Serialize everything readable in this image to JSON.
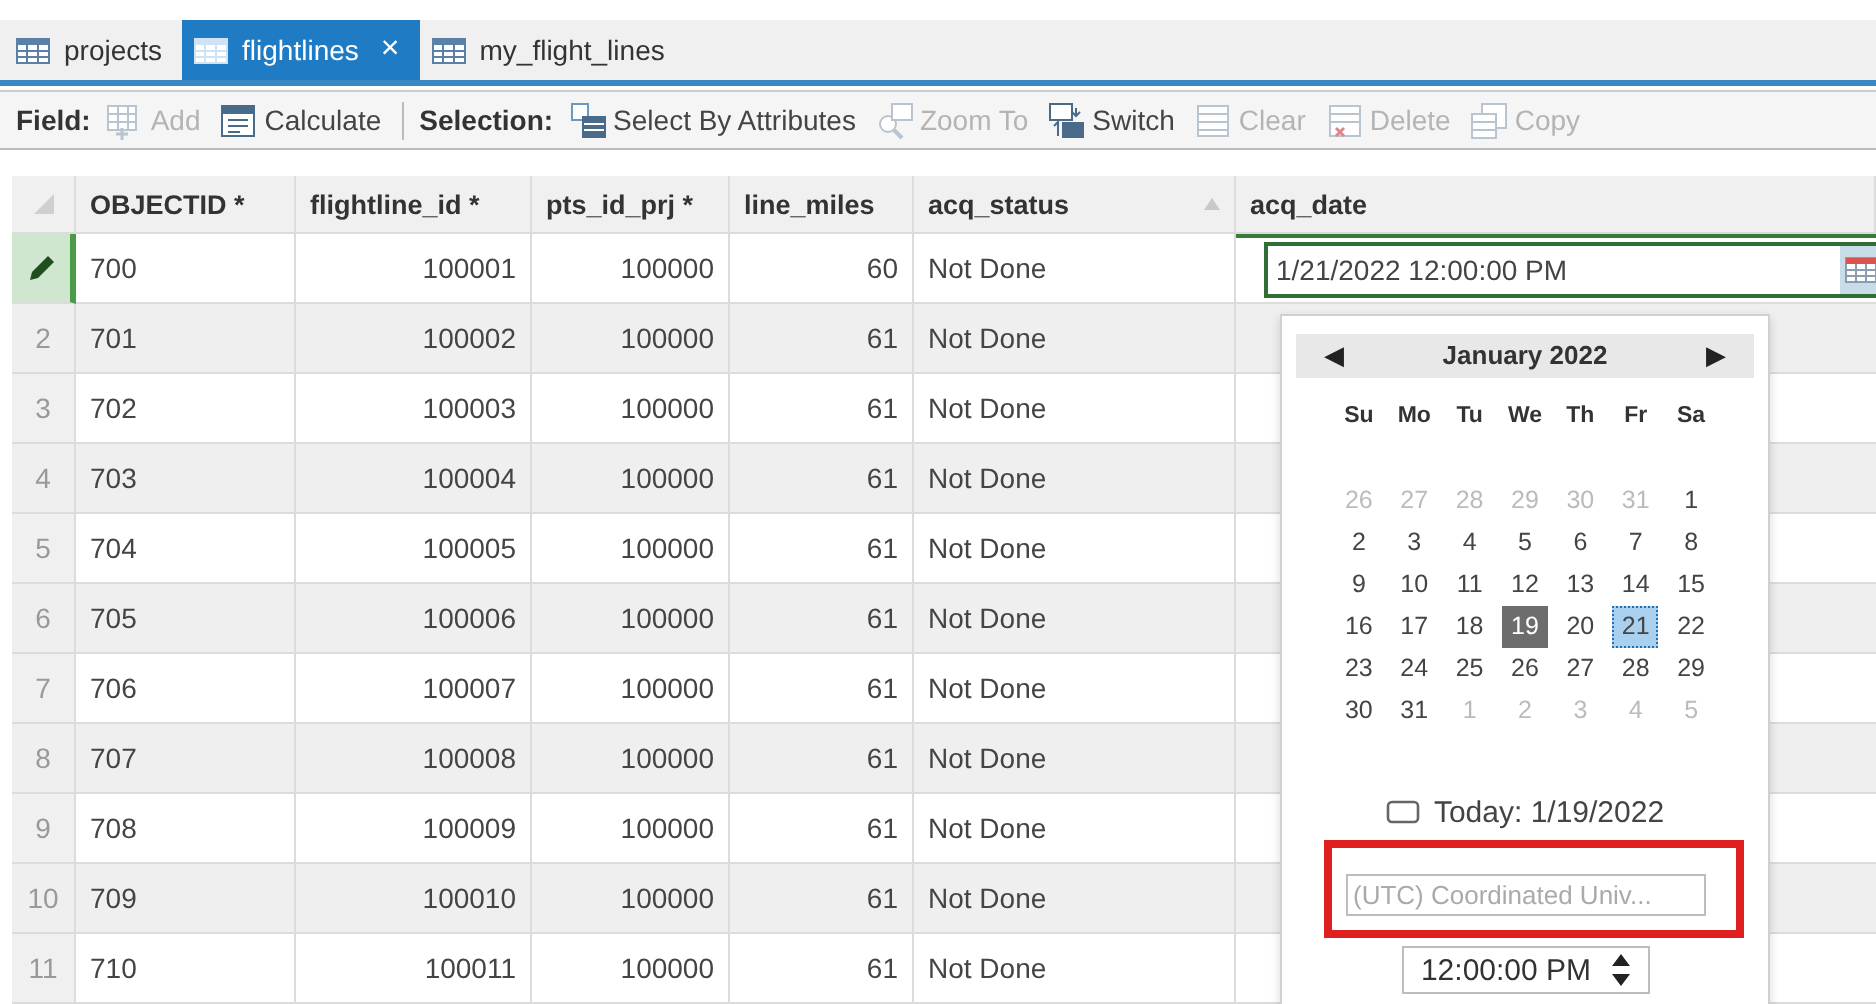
{
  "tabs": [
    {
      "label": "projects",
      "selected": false
    },
    {
      "label": "flightlines",
      "selected": true,
      "close": "×"
    },
    {
      "label": "my_flight_lines",
      "selected": false
    }
  ],
  "toolbar": {
    "groups": [
      {
        "label": "Field:",
        "buttons": [
          {
            "label": "Add",
            "disabled": true
          },
          {
            "label": "Calculate",
            "disabled": false
          }
        ]
      },
      {
        "label": "Selection:",
        "buttons": [
          {
            "label": "Select By Attributes",
            "disabled": false
          },
          {
            "label": "Zoom To",
            "disabled": true
          },
          {
            "label": "Switch",
            "disabled": false
          },
          {
            "label": "Clear",
            "disabled": true
          },
          {
            "label": "Delete",
            "disabled": true
          },
          {
            "label": "Copy",
            "disabled": true
          }
        ]
      }
    ]
  },
  "table": {
    "columns": [
      {
        "label": "OBJECTID *",
        "kind": "text",
        "sorted": false
      },
      {
        "label": "flightline_id *",
        "kind": "number",
        "sorted": false
      },
      {
        "label": "pts_id_prj *",
        "kind": "number",
        "sorted": false
      },
      {
        "label": "line_miles",
        "kind": "number",
        "sorted": false
      },
      {
        "label": "acq_status",
        "kind": "text",
        "sorted": true
      },
      {
        "label": "acq_date",
        "kind": "date",
        "sorted": false
      }
    ],
    "rows": [
      {
        "kind": "editing",
        "cells": [
          "700",
          "100001",
          "100000",
          "60",
          "Not Done"
        ]
      },
      {
        "kind": "normal",
        "number": "2",
        "cells": [
          "701",
          "100002",
          "100000",
          "61",
          "Not Done"
        ]
      },
      {
        "kind": "normal",
        "number": "3",
        "cells": [
          "702",
          "100003",
          "100000",
          "61",
          "Not Done"
        ]
      },
      {
        "kind": "normal",
        "number": "4",
        "cells": [
          "703",
          "100004",
          "100000",
          "61",
          "Not Done"
        ]
      },
      {
        "kind": "normal",
        "number": "5",
        "cells": [
          "704",
          "100005",
          "100000",
          "61",
          "Not Done"
        ]
      },
      {
        "kind": "normal",
        "number": "6",
        "cells": [
          "705",
          "100006",
          "100000",
          "61",
          "Not Done"
        ]
      },
      {
        "kind": "normal",
        "number": "7",
        "cells": [
          "706",
          "100007",
          "100000",
          "61",
          "Not Done"
        ]
      },
      {
        "kind": "normal",
        "number": "8",
        "cells": [
          "707",
          "100008",
          "100000",
          "61",
          "Not Done"
        ]
      },
      {
        "kind": "normal",
        "number": "9",
        "cells": [
          "708",
          "100009",
          "100000",
          "61",
          "Not Done"
        ]
      },
      {
        "kind": "normal",
        "number": "10",
        "cells": [
          "709",
          "100010",
          "100000",
          "61",
          "Not Done"
        ]
      },
      {
        "kind": "normal",
        "number": "11",
        "cells": [
          "710",
          "100011",
          "100000",
          "61",
          "Not Done"
        ]
      }
    ],
    "editor": {
      "value": "1/21/2022 12:00:00 PM"
    }
  },
  "date_picker": {
    "prev": "◀",
    "month": "January 2022",
    "next": "▶",
    "weekdays": [
      "Su",
      "Mo",
      "Tu",
      "We",
      "Th",
      "Fr",
      "Sa"
    ],
    "days": [
      {
        "label": "26",
        "other_month": true,
        "today": false,
        "selected": false
      },
      {
        "label": "27",
        "other_month": true,
        "today": false,
        "selected": false
      },
      {
        "label": "28",
        "other_month": true,
        "today": false,
        "selected": false
      },
      {
        "label": "29",
        "other_month": true,
        "today": false,
        "selected": false
      },
      {
        "label": "30",
        "other_month": true,
        "today": false,
        "selected": false
      },
      {
        "label": "31",
        "other_month": true,
        "today": false,
        "selected": false
      },
      {
        "label": "1",
        "other_month": false,
        "today": false,
        "selected": false
      },
      {
        "label": "2",
        "other_month": false,
        "today": false,
        "selected": false
      },
      {
        "label": "3",
        "other_month": false,
        "today": false,
        "selected": false
      },
      {
        "label": "4",
        "other_month": false,
        "today": false,
        "selected": false
      },
      {
        "label": "5",
        "other_month": false,
        "today": false,
        "selected": false
      },
      {
        "label": "6",
        "other_month": false,
        "today": false,
        "selected": false
      },
      {
        "label": "7",
        "other_month": false,
        "today": false,
        "selected": false
      },
      {
        "label": "8",
        "other_month": false,
        "today": false,
        "selected": false
      },
      {
        "label": "9",
        "other_month": false,
        "today": false,
        "selected": false
      },
      {
        "label": "10",
        "other_month": false,
        "today": false,
        "selected": false
      },
      {
        "label": "11",
        "other_month": false,
        "today": false,
        "selected": false
      },
      {
        "label": "12",
        "other_month": false,
        "today": false,
        "selected": false
      },
      {
        "label": "13",
        "other_month": false,
        "today": false,
        "selected": false
      },
      {
        "label": "14",
        "other_month": false,
        "today": false,
        "selected": false
      },
      {
        "label": "15",
        "other_month": false,
        "today": false,
        "selected": false
      },
      {
        "label": "16",
        "other_month": false,
        "today": false,
        "selected": false
      },
      {
        "label": "17",
        "other_month": false,
        "today": false,
        "selected": false
      },
      {
        "label": "18",
        "other_month": false,
        "today": false,
        "selected": false
      },
      {
        "label": "19",
        "other_month": false,
        "today": true,
        "selected": false
      },
      {
        "label": "20",
        "other_month": false,
        "today": false,
        "selected": false
      },
      {
        "label": "21",
        "other_month": false,
        "today": false,
        "selected": true
      },
      {
        "label": "22",
        "other_month": false,
        "today": false,
        "selected": false
      },
      {
        "label": "23",
        "other_month": false,
        "today": false,
        "selected": false
      },
      {
        "label": "24",
        "other_month": false,
        "today": false,
        "selected": false
      },
      {
        "label": "25",
        "other_month": false,
        "today": false,
        "selected": false
      },
      {
        "label": "26",
        "other_month": false,
        "today": false,
        "selected": false
      },
      {
        "label": "27",
        "other_month": false,
        "today": false,
        "selected": false
      },
      {
        "label": "28",
        "other_month": false,
        "today": false,
        "selected": false
      },
      {
        "label": "29",
        "other_month": false,
        "today": false,
        "selected": false
      },
      {
        "label": "30",
        "other_month": false,
        "today": false,
        "selected": false
      },
      {
        "label": "31",
        "other_month": false,
        "today": false,
        "selected": false
      },
      {
        "label": "1",
        "other_month": true,
        "today": false,
        "selected": false
      },
      {
        "label": "2",
        "other_month": true,
        "today": false,
        "selected": false
      },
      {
        "label": "3",
        "other_month": true,
        "today": false,
        "selected": false
      },
      {
        "label": "4",
        "other_month": true,
        "today": false,
        "selected": false
      },
      {
        "label": "5",
        "other_month": true,
        "today": false,
        "selected": false
      }
    ],
    "today_label": "Today: 1/19/2022",
    "timezone": {
      "value": "(UTC) Coordinated Univ...",
      "disabled": true
    },
    "time": "12:00:00 PM"
  }
}
